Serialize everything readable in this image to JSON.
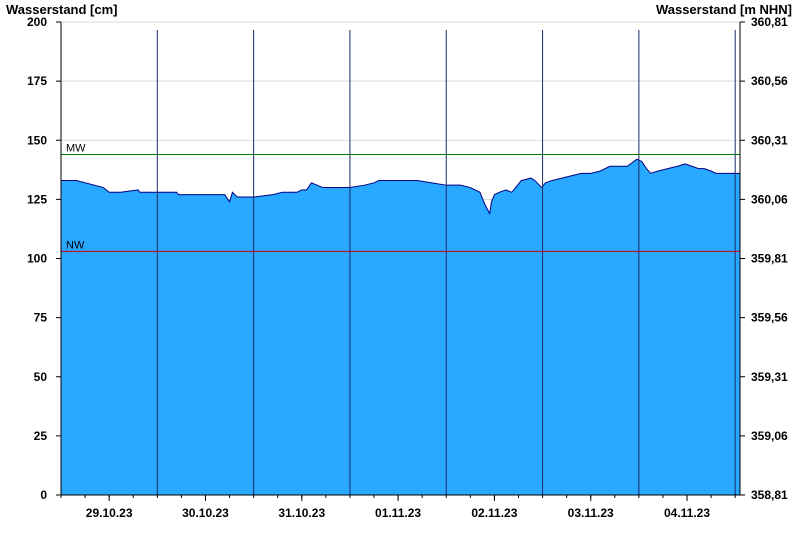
{
  "chart_data": {
    "type": "area",
    "title": "",
    "ylabel_left": "Wasserstand [cm]",
    "ylabel_right": "Wasserstand [m NHN]",
    "ylim": [
      0,
      200
    ],
    "y_ticks_left": [
      "0",
      "25",
      "50",
      "75",
      "100",
      "125",
      "150",
      "175",
      "200"
    ],
    "y_ticks_right": [
      "358,81",
      "359,06",
      "359,31",
      "359,56",
      "359,81",
      "360,06",
      "360,31",
      "360,56",
      "360,81"
    ],
    "x_days": [
      "29.10.23",
      "30.10.23",
      "31.10.23",
      "01.11.23",
      "02.11.23",
      "03.11.23",
      "04.11.23"
    ],
    "x_range_days": [
      0,
      7.05
    ],
    "grid": true,
    "reference_lines": [
      {
        "label": "MW",
        "value": 144,
        "color": "#007700"
      },
      {
        "label": "NW",
        "value": 103,
        "color": "#cc0000"
      }
    ],
    "fill_color": "#29a8ff",
    "line_color": "#000080",
    "series": [
      {
        "x": [
          0.0,
          0.16,
          0.44,
          0.5,
          0.62,
          0.8,
          0.82,
          0.9,
          1.0,
          1.2,
          1.22,
          1.3,
          1.4,
          1.6,
          1.7,
          1.75,
          1.78,
          1.83,
          1.87,
          1.93,
          2.0,
          2.2,
          2.3,
          2.45,
          2.5,
          2.55,
          2.6,
          2.72,
          2.75,
          3.0,
          3.15,
          3.25,
          3.3,
          3.5,
          3.7,
          3.85,
          4.0,
          4.15,
          4.25,
          4.35,
          4.4,
          4.45,
          4.47,
          4.5,
          4.55,
          4.62,
          4.68,
          4.72,
          4.78,
          4.88,
          4.92,
          4.99,
          5.03,
          5.1,
          5.2,
          5.3,
          5.4,
          5.5,
          5.6,
          5.65,
          5.7,
          5.8,
          5.88,
          5.98,
          6.03,
          6.08,
          6.12,
          6.2,
          6.3,
          6.4,
          6.48,
          6.55,
          6.62,
          6.68,
          6.75,
          6.8,
          6.88,
          7.05
        ],
        "values": [
          133,
          133,
          130,
          128,
          128,
          129,
          128,
          128,
          128,
          128,
          127,
          127,
          127,
          127,
          127,
          124,
          128,
          126,
          126,
          126,
          126,
          127,
          128,
          128,
          129,
          129,
          132,
          130,
          130,
          130,
          131,
          132,
          133,
          133,
          133,
          132,
          131,
          131,
          130,
          128,
          123,
          119,
          124,
          127,
          128,
          129,
          128,
          130,
          133,
          134,
          133,
          130,
          132,
          133,
          134,
          135,
          136,
          136,
          137,
          138,
          139,
          139,
          139,
          142,
          141,
          138,
          136,
          137,
          138,
          139,
          140,
          139,
          138,
          138,
          137,
          136,
          136,
          136
        ]
      }
    ]
  }
}
